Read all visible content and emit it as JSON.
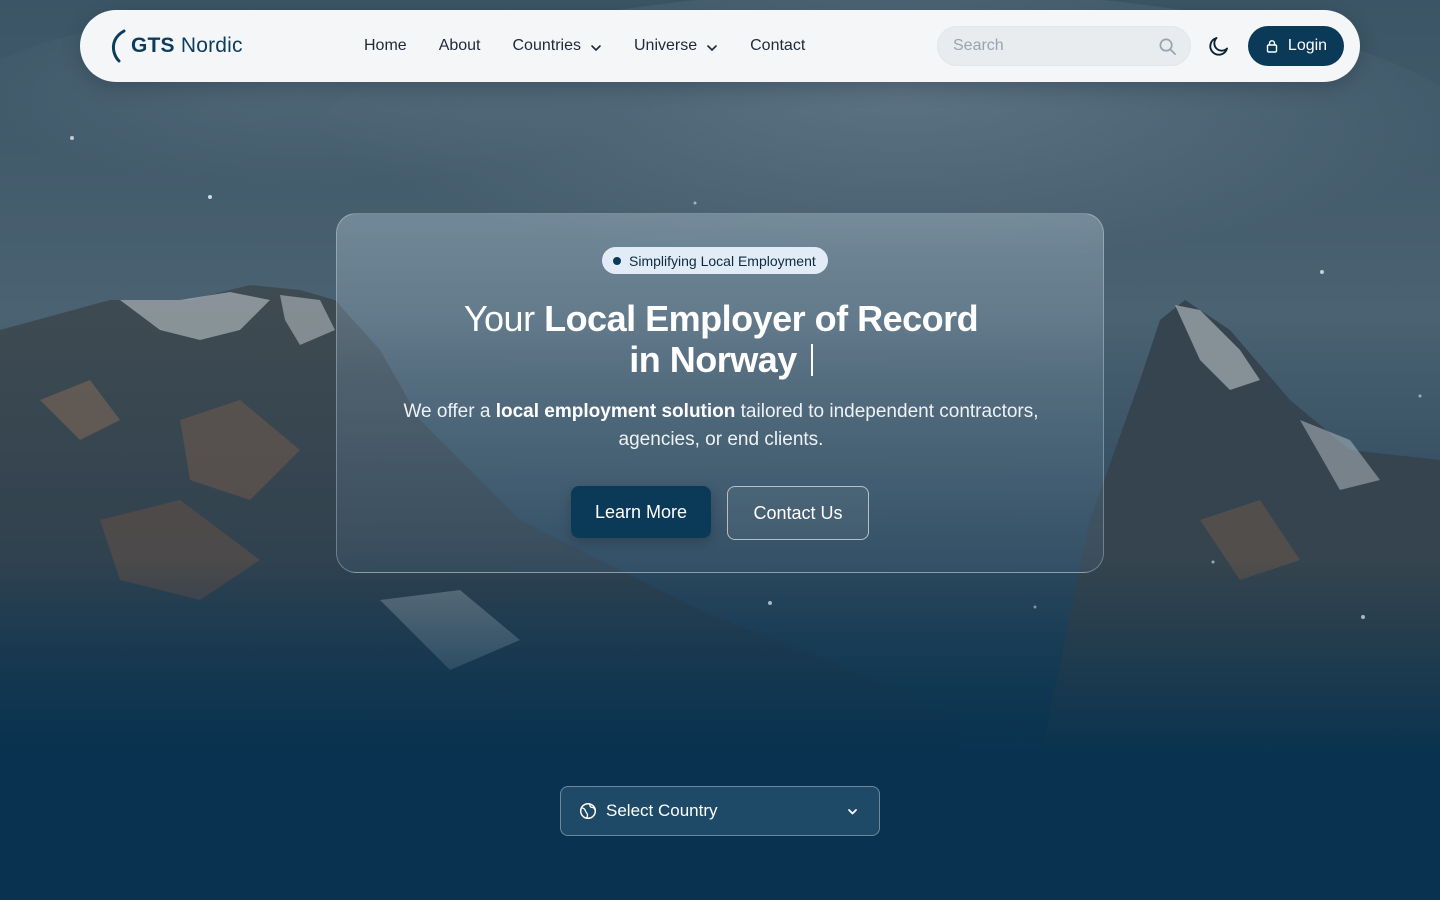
{
  "brand": {
    "logo_bold": "GTS",
    "logo_light": "Nordic"
  },
  "nav": {
    "links": [
      {
        "label": "Home",
        "dropdown": false
      },
      {
        "label": "About",
        "dropdown": false
      },
      {
        "label": "Countries",
        "dropdown": true
      },
      {
        "label": "Universe",
        "dropdown": true
      },
      {
        "label": "Contact",
        "dropdown": false
      }
    ],
    "search_placeholder": "Search",
    "login_label": "Login"
  },
  "hero": {
    "badge": "Simplifying Local Employment",
    "headline_prefix": "Your",
    "headline_bold": "Local Employer of Record",
    "headline_line2": "in Norway",
    "sub_prefix": "We offer a",
    "sub_bold": "local employment solution",
    "sub_suffix": "tailored to independent contractors, agencies, or end clients.",
    "primary_button": "Learn More",
    "secondary_button": "Contact Us"
  },
  "country_select": {
    "label": "Select Country"
  },
  "colors": {
    "primary": "#0b3a59",
    "nav_background": "#f4f6f8",
    "page_bottom": "#08324f",
    "badge_background": "#e2ecf6"
  },
  "icons": [
    "search-icon",
    "moon-icon",
    "lock-icon",
    "chevron-down-icon",
    "globe-icon"
  ]
}
